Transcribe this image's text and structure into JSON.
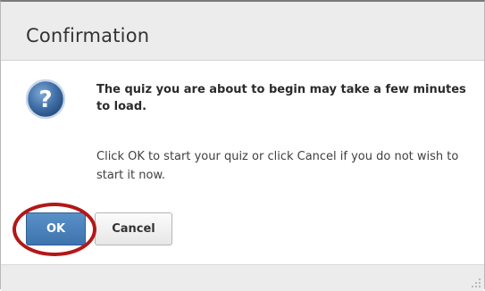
{
  "dialog": {
    "title": "Confirmation",
    "icon": "question-icon",
    "message_bold": "The quiz you are about to begin may take a few minutes to load.",
    "message": "Click OK to start your quiz or click Cancel if you do not wish to start it now.",
    "buttons": {
      "ok_label": "OK",
      "cancel_label": "Cancel"
    },
    "highlight": {
      "target": "OK",
      "color": "#b31717"
    }
  },
  "colors": {
    "accent": "#3d74ae",
    "titlebar": "#ececec"
  }
}
